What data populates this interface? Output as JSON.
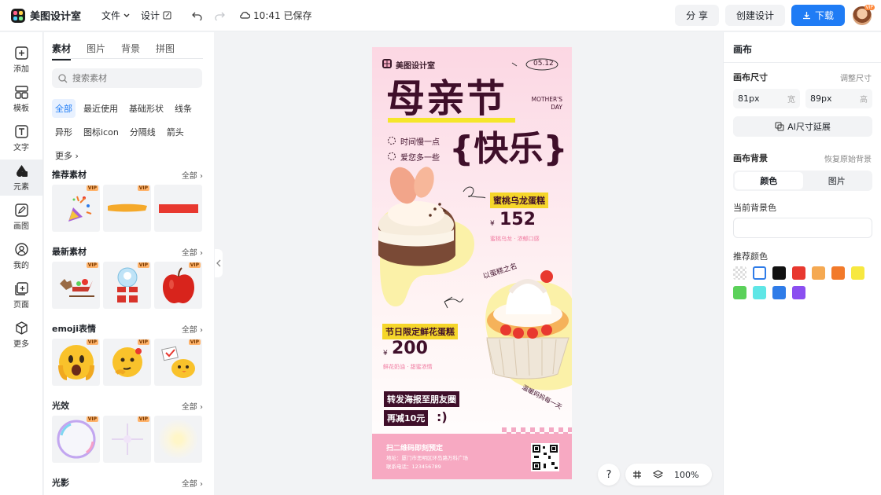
{
  "app": {
    "name": "美图设计室"
  },
  "topbar": {
    "menu_file": "文件",
    "menu_design": "设计",
    "saved_status": "10:41 已保存",
    "share": "分 享",
    "create_design": "创建设计",
    "download": "下载",
    "avatar_badge": "VIP"
  },
  "rail": {
    "items": [
      {
        "label": "添加",
        "icon": "plus-square-icon"
      },
      {
        "label": "模板",
        "icon": "template-icon"
      },
      {
        "label": "文字",
        "icon": "text-icon"
      },
      {
        "label": "元素",
        "icon": "shapes-icon"
      },
      {
        "label": "画图",
        "icon": "pencil-icon"
      },
      {
        "label": "我的",
        "icon": "user-icon"
      },
      {
        "label": "页面",
        "icon": "page-add-icon"
      },
      {
        "label": "更多",
        "icon": "cube-icon"
      }
    ]
  },
  "panel": {
    "tabs": [
      "素材",
      "图片",
      "背景",
      "拼图"
    ],
    "search_placeholder": "搜索素材",
    "chips": [
      "全部",
      "最近使用",
      "基础形状",
      "线条",
      "异形",
      "图标icon",
      "分隔线",
      "箭头",
      "更多 ›"
    ],
    "all_label": "全部",
    "vip_label": "VIP",
    "sections": [
      {
        "title": "推荐素材"
      },
      {
        "title": "最新素材"
      },
      {
        "title": "emoji表情"
      },
      {
        "title": "光效"
      },
      {
        "title": "光影"
      }
    ]
  },
  "poster": {
    "brand": "美图设计室",
    "date": "05.12",
    "headline": "母亲节",
    "headline2": "{快乐}",
    "mothers_day_en": "MOTHER'S DAY",
    "line1": "时间慢一点",
    "line2": "爱您多一些",
    "product1_name": "蜜桃乌龙蛋糕",
    "product1_currency": "¥",
    "product1_price": "152",
    "product1_desc": "蜜桃乌龙 · 浓郁口感",
    "tagline_mid": "以蛋糕之名",
    "product2_name": "节日限定鲜花蛋糕",
    "product2_currency": "¥",
    "product2_price": "200",
    "product2_desc": "鲜花奶油 · 甜蜜浓情",
    "tagline_bottom": "温暖妈妈每一天",
    "share_text": "转发海报至朋友圈",
    "discount_text": "再减10元",
    "smile": ":)",
    "footer_title": "扫二维码即刻预定",
    "footer_addr": "地址：厦门市思明区环岛路万科广场",
    "footer_phone": "联系电话：123456789"
  },
  "right": {
    "title": "画布",
    "size_label": "画布尺寸",
    "adjust_label": "调整尺寸",
    "width_value": "81px",
    "width_unit": "宽",
    "height_value": "89px",
    "height_unit": "高",
    "ai_extend": "AI尺寸延展",
    "bg_label": "画布背景",
    "restore_label": "恢复原始背景",
    "seg_color": "颜色",
    "seg_image": "图片",
    "current_color_label": "当前背景色",
    "recommend_label": "推荐颜色",
    "colors": [
      "#ffffff",
      "#111111",
      "#e8382f",
      "#f5a952",
      "#f27a2a",
      "#f7e840",
      "#5bd15a",
      "#5fe6e6",
      "#2f7ce8",
      "#8b4ff0"
    ]
  },
  "bottom": {
    "help": "?",
    "zoom": "100%"
  }
}
